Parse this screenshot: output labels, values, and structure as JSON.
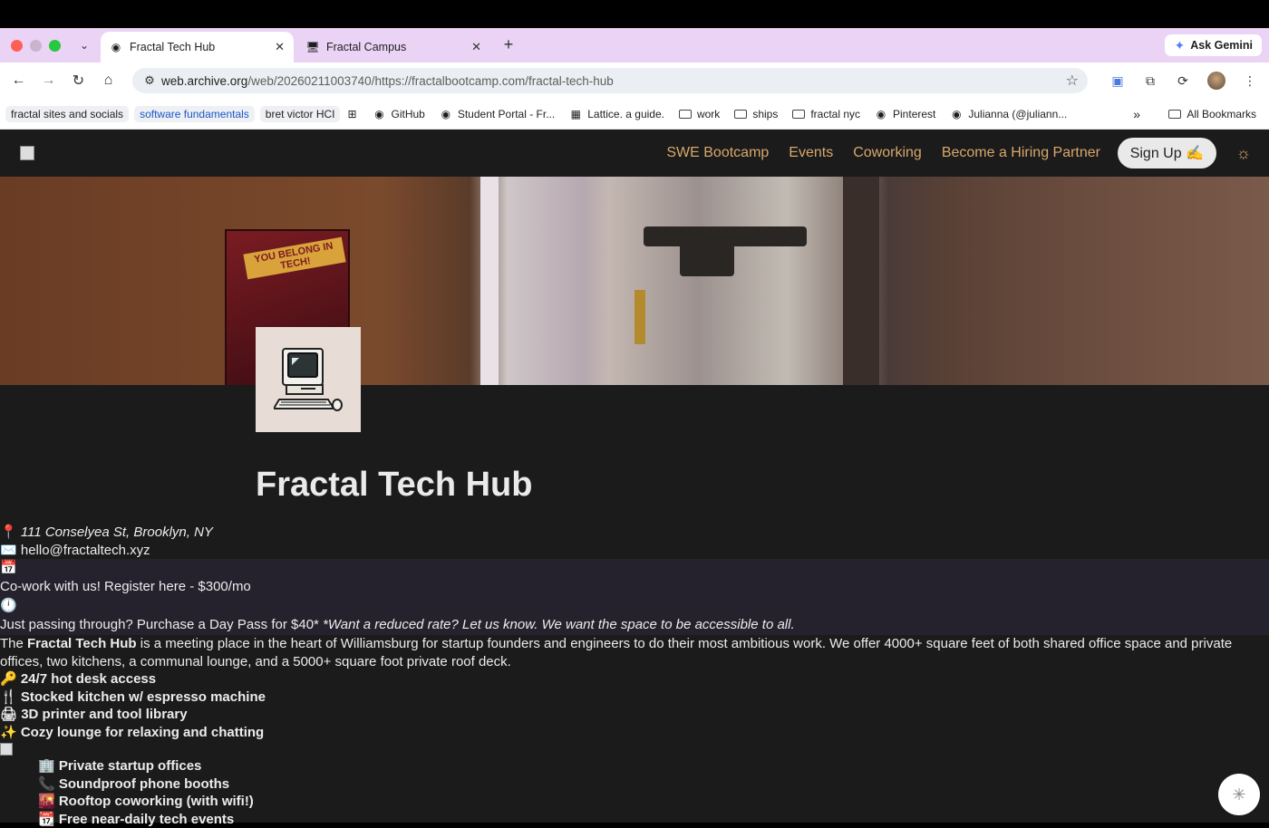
{
  "browser": {
    "tabs": [
      {
        "label": "Fractal Tech Hub",
        "active": true
      },
      {
        "label": "Fractal Campus",
        "active": false
      }
    ],
    "ask_gemini": "Ask Gemini",
    "url_domain": "web.archive.org",
    "url_path": "/web/20260211003740/https://fractalbootcamp.com/fractal-tech-hub",
    "bookmarks": {
      "chips": [
        "fractal sites and socials",
        "software fundamentals",
        "bret victor HCI"
      ],
      "items": [
        "GitHub",
        "Student Portal - Fr...",
        "Lattice. a guide.",
        "work",
        "ships",
        "fractal nyc",
        "Pinterest",
        "Julianna (@juliann..."
      ],
      "all": "All Bookmarks"
    }
  },
  "site": {
    "nav": {
      "links": [
        "SWE Bootcamp",
        "Events",
        "Coworking",
        "Become a Hiring Partner"
      ],
      "signup": "Sign Up ✍️"
    },
    "hero": {
      "poster_text": "YOU BELONG IN TECH!"
    },
    "title": "Fractal Tech Hub",
    "address": "111 Conselyea St, Brooklyn, NY",
    "email": "hello@fractaltech.xyz",
    "cowork": "Co-work with us! Register here - $300/mo",
    "daypass": "Just passing through? Purchase a Day Pass for $40*",
    "daypass_note": "*Want a reduced rate? Let us know. We want the space to be accessible to all.",
    "desc_pre": "The ",
    "desc_bold": "Fractal Tech Hub",
    "desc_post": " is a meeting place in the heart of Williamsburg for startup founders and engineers to do their most ambitious work. We offer 4000+ square feet of both shared office space and private offices, two kitchens, a communal lounge, and a 5000+ square foot private roof deck.",
    "features": [
      "🔑 24/7 hot desk access",
      "🍴 Stocked kitchen w/ espresso machine",
      "🖨 3D printer and tool library",
      "✨ Cozy lounge for relaxing and chatting"
    ],
    "features2": [
      "🏢 Private startup offices",
      "📞 Soundproof phone booths",
      "🌇 Rooftop coworking (with wifi!)",
      "📆 Free near-daily tech events"
    ]
  },
  "colors": {
    "accent": "#d9a76a",
    "background": "#1b1b1c",
    "tabstrip": "#ead3f5"
  }
}
